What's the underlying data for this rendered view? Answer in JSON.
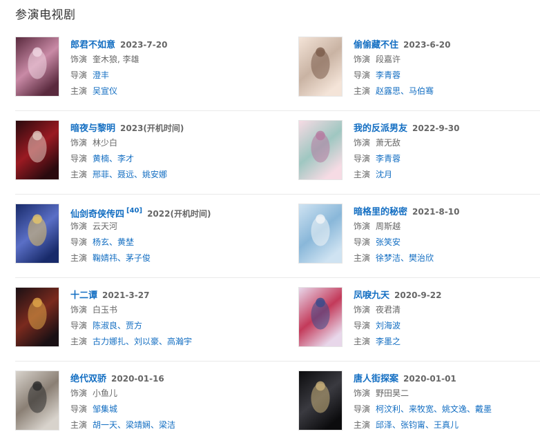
{
  "section_title": "参演电视剧",
  "labels": {
    "role": "饰演",
    "director": "导演",
    "starring": "主演"
  },
  "dramas": [
    {
      "title": "郎君不如意",
      "date": "2023-7-20",
      "role": "奎木狼, 李雄",
      "director": "澄丰",
      "starring": "吴宣仪",
      "poster_colors": [
        "#5a2a3e",
        "#c98aa6",
        "#f0d6e2"
      ]
    },
    {
      "title": "偷偷藏不住",
      "date": "2023-6-20",
      "role": "段嘉许",
      "director": "李青蓉",
      "starring": "赵露思、马伯骞",
      "poster_colors": [
        "#f4e4d8",
        "#c9b3a3",
        "#7a5b4a"
      ]
    },
    {
      "title": "暗夜与黎明",
      "date": "2023(开机时间)",
      "role": "林少白",
      "director": "黄楠、李才",
      "starring": "邢菲、聂远、姚安娜",
      "poster_colors": [
        "#2a0a0e",
        "#9a1a22",
        "#e2c9c0"
      ]
    },
    {
      "title": "我的反派男友",
      "date": "2022-9-30",
      "role": "萧无敌",
      "director": "李青蓉",
      "starring": "沈月",
      "poster_colors": [
        "#f6dbe4",
        "#9fc7c1",
        "#b57aa0"
      ]
    },
    {
      "title": "仙剑奇侠传四",
      "sup": "[40]",
      "date": "2022(开机时间)",
      "role": "云天河",
      "director": "杨玄、黄埜",
      "starring": "鞠婧祎、茅子俊",
      "poster_colors": [
        "#182a6a",
        "#5a6fc6",
        "#e5c56a"
      ]
    },
    {
      "title": "暗格里的秘密",
      "date": "2021-8-10",
      "role": "周斯越",
      "director": "张笑安",
      "starring": "徐梦洁、樊治欣",
      "poster_colors": [
        "#cfe3f2",
        "#89b7d9",
        "#f2f5f8"
      ]
    },
    {
      "title": "十二谭",
      "date": "2021-3-27",
      "role": "白玉书",
      "director": "陈淑良、贾方",
      "starring": "古力娜扎、刘以豪、高瀚宇",
      "poster_colors": [
        "#1a1014",
        "#7a2a1e",
        "#e0a548"
      ]
    },
    {
      "title": "凤唳九天",
      "date": "2020-9-22",
      "role": "夜君清",
      "director": "刘海波",
      "starring": "李墨之",
      "poster_colors": [
        "#e8d7ea",
        "#c33a5a",
        "#3a4a8a"
      ]
    },
    {
      "title": "绝代双骄",
      "date": "2020-01-16",
      "role": "小鱼儿",
      "director": "邹集城",
      "starring": "胡一天、梁靖娴、梁洁",
      "poster_colors": [
        "#d8d3cc",
        "#8a7f74",
        "#2b2b2b"
      ]
    },
    {
      "title": "唐人街探案",
      "date": "2020-01-01",
      "role": "野田昊二",
      "director": "柯汶利、来牧宽、姚文逸、戴墨",
      "starring": "邱泽、张钧甯、王真儿",
      "poster_colors": [
        "#0c0c0e",
        "#3a3a40",
        "#c9b07a"
      ]
    }
  ]
}
